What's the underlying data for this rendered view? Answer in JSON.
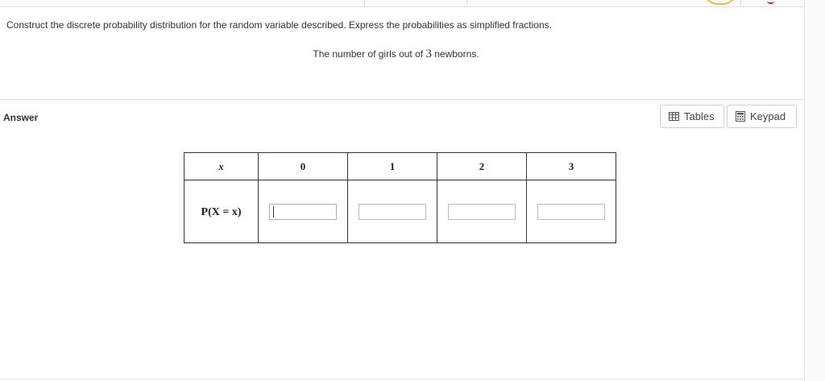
{
  "question": {
    "instruction": "Construct the discrete probability distribution for the random variable described. Express the probabilities as simplified fractions.",
    "description_before": "The number of girls out of ",
    "description_number": "3",
    "description_after": " newborns."
  },
  "answer": {
    "label": "Answer",
    "tables_button": "Tables",
    "keypad_button": "Keypad"
  },
  "table": {
    "x_header": "x",
    "x_values": [
      "0",
      "1",
      "2",
      "3"
    ],
    "p_header": "P(X = x)",
    "p_values": [
      "",
      "",
      "",
      ""
    ]
  },
  "colors": {
    "border": "#333333",
    "divider": "#e2e2e2",
    "button_border": "#cfcfcf"
  }
}
